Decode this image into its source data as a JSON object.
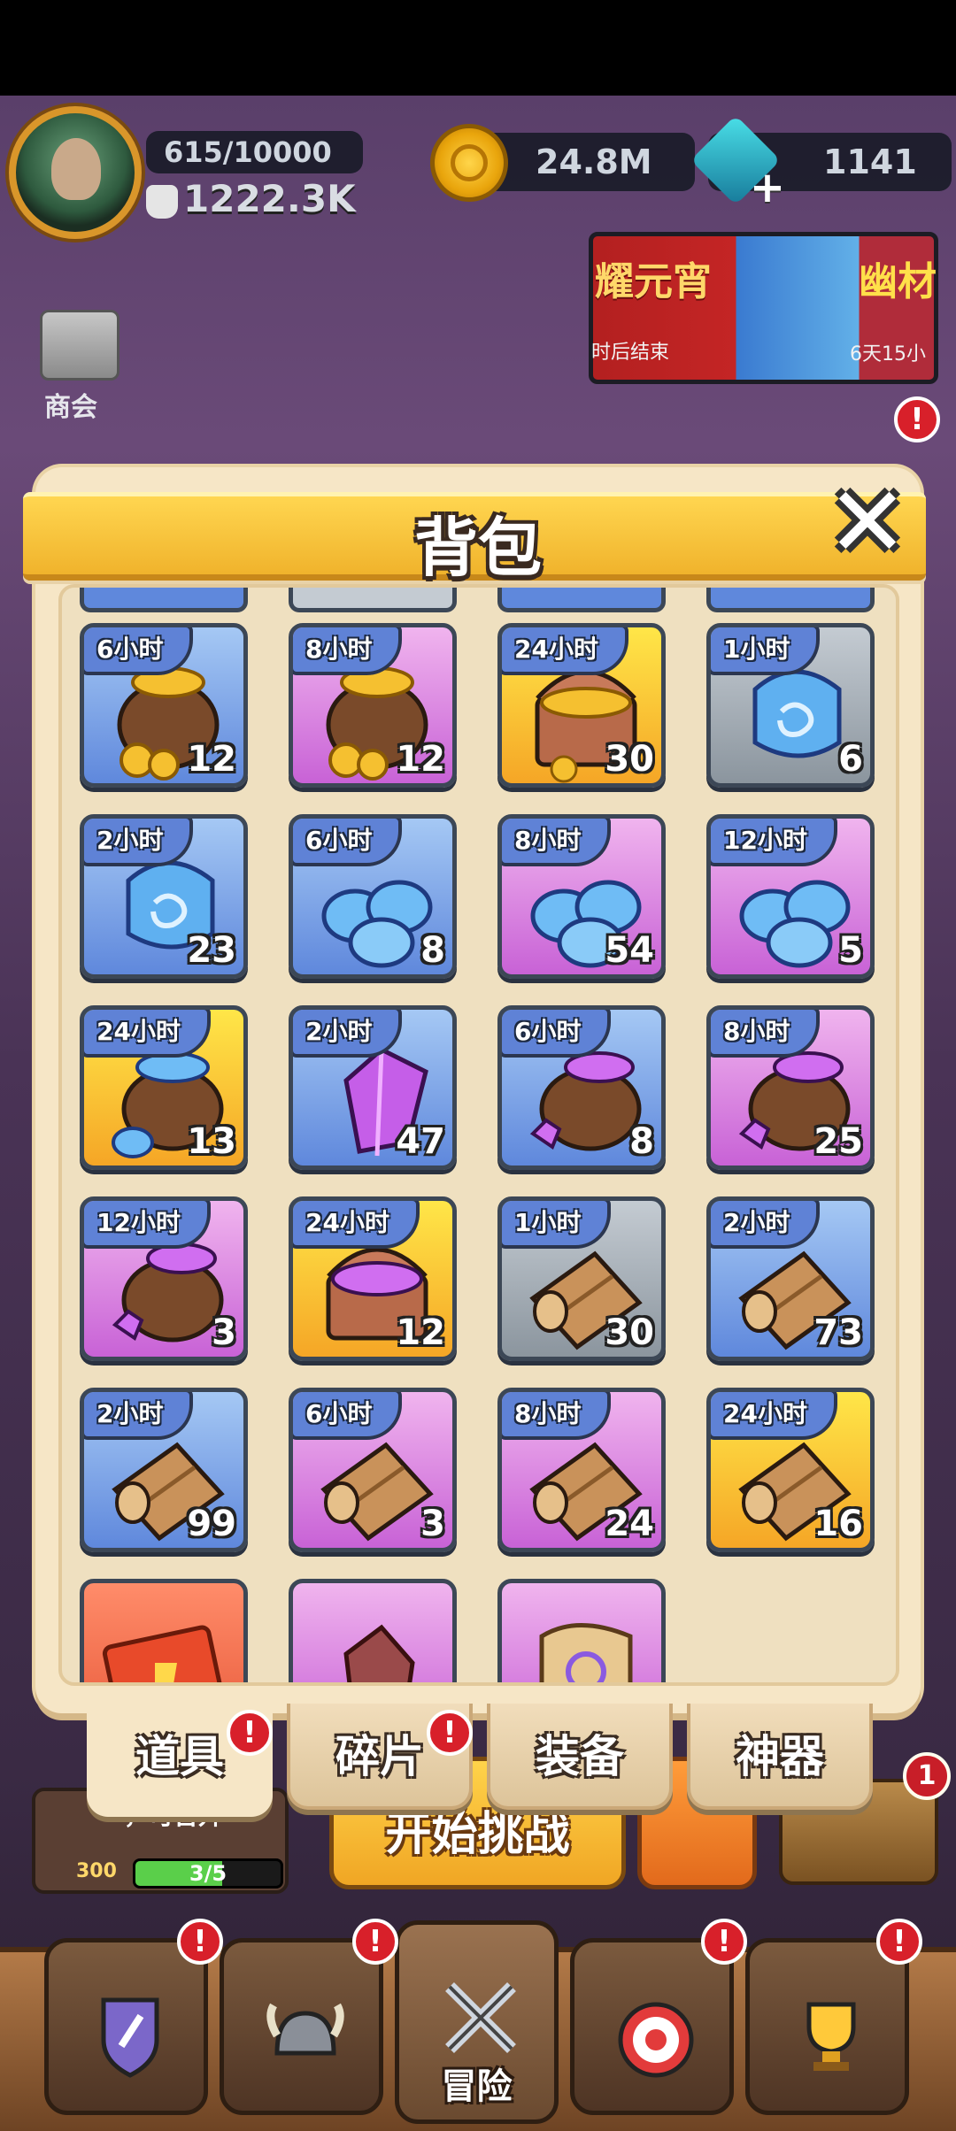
{
  "hud": {
    "xp": "615/10000",
    "power": "1222.3K",
    "gold": "24.8M",
    "gems": "1141",
    "shop_label": "商会",
    "banner": {
      "title_left": "耀元宵",
      "sub_left": "时后结束",
      "title_right": "幽材",
      "sub_right": "6天15小"
    }
  },
  "panel": {
    "title": "背包",
    "close_label": "✕"
  },
  "items": [
    {
      "tag": "6小时",
      "qty": "12",
      "color": "blue",
      "icon": "gold-coin-sack-icon"
    },
    {
      "tag": "8小时",
      "qty": "12",
      "color": "pink",
      "icon": "gold-coin-sack-icon"
    },
    {
      "tag": "24小时",
      "qty": "30",
      "color": "gold",
      "icon": "gold-treasure-chest-icon"
    },
    {
      "tag": "1小时",
      "qty": "6",
      "color": "grey",
      "icon": "blue-spiral-orb-icon"
    },
    {
      "tag": "2小时",
      "qty": "23",
      "color": "blue",
      "icon": "blue-spiral-orb-icon"
    },
    {
      "tag": "6小时",
      "qty": "8",
      "color": "blue",
      "icon": "blue-orb-pile-icon"
    },
    {
      "tag": "8小时",
      "qty": "54",
      "color": "pink",
      "icon": "blue-orb-pile-icon"
    },
    {
      "tag": "12小时",
      "qty": "5",
      "color": "pink",
      "icon": "blue-orb-pile-icon"
    },
    {
      "tag": "24小时",
      "qty": "13",
      "color": "gold",
      "icon": "blue-orb-sack-icon"
    },
    {
      "tag": "2小时",
      "qty": "47",
      "color": "blue",
      "icon": "purple-crystal-icon"
    },
    {
      "tag": "6小时",
      "qty": "8",
      "color": "blue",
      "icon": "purple-crystal-sack-icon"
    },
    {
      "tag": "8小时",
      "qty": "25",
      "color": "pink",
      "icon": "purple-crystal-sack-icon"
    },
    {
      "tag": "12小时",
      "qty": "3",
      "color": "pink",
      "icon": "purple-crystal-sack-icon"
    },
    {
      "tag": "24小时",
      "qty": "12",
      "color": "gold",
      "icon": "purple-crystal-chest-icon"
    },
    {
      "tag": "1小时",
      "qty": "30",
      "color": "grey",
      "icon": "wood-log-icon"
    },
    {
      "tag": "2小时",
      "qty": "73",
      "color": "blue",
      "icon": "wood-log-icon"
    },
    {
      "tag": "2小时",
      "qty": "99",
      "color": "blue",
      "icon": "wood-log-icon"
    },
    {
      "tag": "6小时",
      "qty": "3",
      "color": "pink",
      "icon": "wood-log-icon"
    },
    {
      "tag": "8小时",
      "qty": "24",
      "color": "pink",
      "icon": "wood-log-icon"
    },
    {
      "tag": "24小时",
      "qty": "16",
      "color": "gold",
      "icon": "wood-log-icon"
    },
    {
      "tag": "",
      "qty": "",
      "color": "red",
      "icon": "red-card-icon"
    },
    {
      "tag": "",
      "qty": "",
      "color": "pink",
      "icon": "red-ore-icon"
    },
    {
      "tag": "",
      "qty": "",
      "color": "pink",
      "icon": "scroll-icon"
    }
  ],
  "tabs": [
    {
      "label": "道具",
      "alert": true,
      "active": true
    },
    {
      "label": "碎片",
      "alert": true,
      "active": false
    },
    {
      "label": "装备",
      "alert": false,
      "active": false
    },
    {
      "label": "神器",
      "alert": false,
      "active": false
    }
  ],
  "background_ui": {
    "progress_text": "，可晋升",
    "progress_value": "3/5",
    "progress_fraction": 0.6,
    "card_number": "300",
    "challenge_label": "开始挑战",
    "side_badge": "1",
    "nav_center_label": "冒险"
  },
  "colors": {
    "blue": "#5f88dc",
    "pink": "#c862d6",
    "gold": "#f5a626",
    "grey": "#8b959e",
    "red": "#e85a3a",
    "alert": "#d8202a"
  }
}
